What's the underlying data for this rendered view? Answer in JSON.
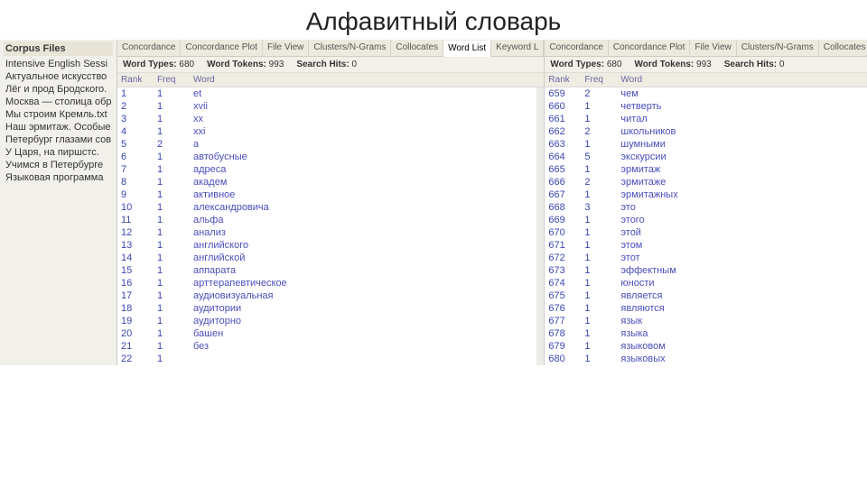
{
  "title": "Алфавитный словарь",
  "corpus": {
    "header": "Corpus Files",
    "files": [
      "Intensive English Sessi",
      "Актуальное искусство",
      "Лёг и прод Бродского.",
      "Москва — столица обр",
      "Мы строим Кремль.txt",
      "Наш эрмитаж. Особые",
      "Петербург глазами сов",
      "У Царя, на пиршстс.",
      "Учимся в Петербурге",
      "Языковая программа"
    ]
  },
  "tabs": [
    "Concordance",
    "Concordance Plot",
    "File View",
    "Clusters/N-Grams",
    "Collocates",
    "Word List",
    "Keyword L"
  ],
  "activeTab": "Word List",
  "leftStats": {
    "wt_label": "Word Types:",
    "wt": "680",
    "wtok_label": "Word Tokens:",
    "wtok": "993",
    "sh_label": "Search Hits:",
    "sh": "0"
  },
  "rightStats": {
    "wt_label": "Word Types:",
    "wt": "680",
    "wtok_label": "Word Tokens:",
    "wtok": "993",
    "sh_label": "Search Hits:",
    "sh": "0"
  },
  "cols": {
    "rank": "Rank",
    "freq": "Freq",
    "word": "Word"
  },
  "leftRows": [
    {
      "r": "1",
      "f": "1",
      "w": "et"
    },
    {
      "r": "2",
      "f": "1",
      "w": "xvii"
    },
    {
      "r": "3",
      "f": "1",
      "w": "xx"
    },
    {
      "r": "4",
      "f": "1",
      "w": "xxi"
    },
    {
      "r": "5",
      "f": "2",
      "w": "а"
    },
    {
      "r": "6",
      "f": "1",
      "w": "автобусные"
    },
    {
      "r": "7",
      "f": "1",
      "w": "адреса"
    },
    {
      "r": "8",
      "f": "1",
      "w": "академ"
    },
    {
      "r": "9",
      "f": "1",
      "w": "активное"
    },
    {
      "r": "10",
      "f": "1",
      "w": "александровича"
    },
    {
      "r": "11",
      "f": "1",
      "w": "альфа"
    },
    {
      "r": "12",
      "f": "1",
      "w": "анализ"
    },
    {
      "r": "13",
      "f": "1",
      "w": "английского"
    },
    {
      "r": "14",
      "f": "1",
      "w": "английской"
    },
    {
      "r": "15",
      "f": "1",
      "w": "аппарата"
    },
    {
      "r": "16",
      "f": "1",
      "w": "арттерапевтическое"
    },
    {
      "r": "17",
      "f": "1",
      "w": "аудиовизуальная"
    },
    {
      "r": "18",
      "f": "1",
      "w": "аудитории"
    },
    {
      "r": "19",
      "f": "1",
      "w": "аудиторно"
    },
    {
      "r": "20",
      "f": "1",
      "w": "башен"
    },
    {
      "r": "21",
      "f": "1",
      "w": "без"
    },
    {
      "r": "22",
      "f": "1",
      "w": ""
    }
  ],
  "rightRows": [
    {
      "r": "659",
      "f": "2",
      "w": "чем"
    },
    {
      "r": "660",
      "f": "1",
      "w": "четверть"
    },
    {
      "r": "661",
      "f": "1",
      "w": "читал"
    },
    {
      "r": "662",
      "f": "2",
      "w": "школьников"
    },
    {
      "r": "663",
      "f": "1",
      "w": "шумными"
    },
    {
      "r": "664",
      "f": "5",
      "w": "экскурсии"
    },
    {
      "r": "665",
      "f": "1",
      "w": "эрмитаж"
    },
    {
      "r": "666",
      "f": "2",
      "w": "эрмитаже"
    },
    {
      "r": "667",
      "f": "1",
      "w": "эрмитажных"
    },
    {
      "r": "668",
      "f": "3",
      "w": "это"
    },
    {
      "r": "669",
      "f": "1",
      "w": "этого"
    },
    {
      "r": "670",
      "f": "1",
      "w": "этой"
    },
    {
      "r": "671",
      "f": "1",
      "w": "этом"
    },
    {
      "r": "672",
      "f": "1",
      "w": "этот"
    },
    {
      "r": "673",
      "f": "1",
      "w": "эффектным"
    },
    {
      "r": "674",
      "f": "1",
      "w": "юности"
    },
    {
      "r": "675",
      "f": "1",
      "w": "является"
    },
    {
      "r": "676",
      "f": "1",
      "w": "являются"
    },
    {
      "r": "677",
      "f": "1",
      "w": "язык"
    },
    {
      "r": "678",
      "f": "1",
      "w": "языка"
    },
    {
      "r": "679",
      "f": "1",
      "w": "языковом"
    },
    {
      "r": "680",
      "f": "1",
      "w": "языковых"
    }
  ]
}
